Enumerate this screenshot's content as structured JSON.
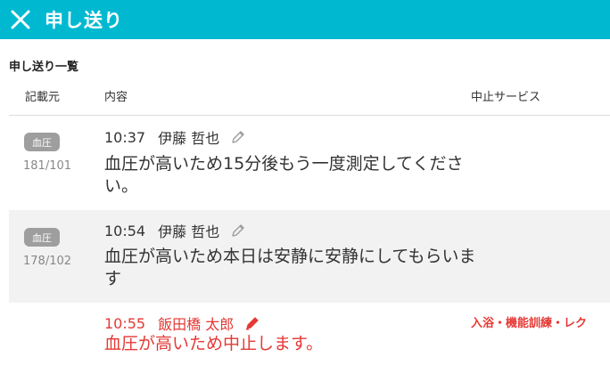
{
  "header": {
    "title": "申し送り",
    "color": "#00b9d1"
  },
  "section": {
    "title": "申し送り一覧"
  },
  "columns": {
    "source": "記載元",
    "content": "内容",
    "stopped_services": "中止サービス"
  },
  "entries": [
    {
      "badge": "血圧",
      "vital": "181/101",
      "time": "10:37",
      "author": "伊藤 哲也",
      "message": "血圧が高いため15分後もう一度測定してください。",
      "stopped_services": "",
      "alert": false
    },
    {
      "badge": "血圧",
      "vital": "178/102",
      "time": "10:54",
      "author": "伊藤 哲也",
      "message": "血圧が高いため本日は安静に安静にしてもらいます",
      "stopped_services": "",
      "alert": false
    },
    {
      "badge": "",
      "vital": "",
      "time": "10:55",
      "author": "飯田橋 太郎",
      "message": "血圧が高いため中止します。",
      "stopped_services": "入浴・機能訓練・レク",
      "alert": true,
      "alert_color": "#e53935"
    }
  ]
}
